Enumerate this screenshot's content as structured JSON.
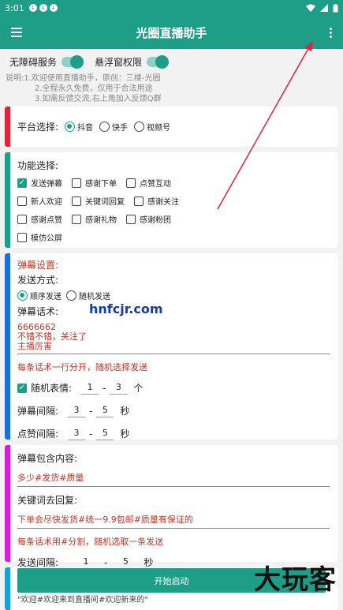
{
  "status_bar": {
    "time": "3:01"
  },
  "app_bar": {
    "title": "光圈直播助手"
  },
  "toggles": [
    {
      "label": "无障碍服务",
      "on": true
    },
    {
      "label": "悬浮窗权限",
      "on": true
    }
  ],
  "intro": {
    "line1": "说明:1.欢迎使用直播助手，原创：三楼-光圈",
    "line2": "2.全程永久免费，仅用于合法用途",
    "line3": "3.如需反馈交流,右上角加入反馈Q群"
  },
  "platform": {
    "label": "平台选择:",
    "options": [
      "抖音",
      "快手",
      "视频号"
    ],
    "selected": "抖音"
  },
  "features": {
    "label": "功能选择:",
    "items": [
      {
        "label": "发送弹幕",
        "checked": true
      },
      {
        "label": "感谢下单",
        "checked": false
      },
      {
        "label": "点赞互动",
        "checked": false
      },
      {
        "label": "新人欢迎",
        "checked": false
      },
      {
        "label": "关键词回复",
        "checked": false
      },
      {
        "label": "感谢关注",
        "checked": false
      },
      {
        "label": "感谢点赞",
        "checked": false
      },
      {
        "label": "感谢礼物",
        "checked": false
      },
      {
        "label": "感谢粉团",
        "checked": false
      },
      {
        "label": "模仿公屏",
        "checked": false
      }
    ]
  },
  "danmu": {
    "title": "弹幕设置:",
    "send_mode_label": "发送方式:",
    "send_modes": [
      "顺序发送",
      "随机发送"
    ],
    "send_mode_selected": "顺序发送",
    "script_label": "弹幕话术:",
    "script_lines": [
      "6666662",
      "不错不错，关注了",
      "主播厉害"
    ],
    "hint": "每条话术一行分开，随机选择发送",
    "random_emoji_label": "随机表情:",
    "random_emoji_checked": true,
    "emoji_min": "1",
    "emoji_max": "3",
    "emoji_unit": "个",
    "interval_label": "弹幕间隔:",
    "interval_min": "3",
    "interval_max": "5",
    "interval_unit": "秒",
    "like_interval_label": "点赞间隔:",
    "like_min": "3",
    "like_max": "5",
    "like_unit": "秒",
    "dash": "-"
  },
  "keywords": {
    "contains_label": "弹幕包含内容:",
    "contains_value": "多少#发货#质量",
    "reply_label": "关键词去回复:",
    "reply_value": "下单会尽快发货#统一9.9包邮#质量有保证的",
    "hint": "每条话术用#分割，随机选取一条发送",
    "interval_label": "发送间隔:",
    "interval_min": "1",
    "interval_max": "5",
    "interval_unit": "秒"
  },
  "welcome": {
    "value": "\"欢迎#欢迎来到直播间#欢迎新来的\""
  },
  "start_button": "开始启动",
  "watermarks": {
    "site": "hnfcjr.com",
    "brand": "大玩客"
  },
  "colors": {
    "primary": "#1f9e87",
    "accent_red": "#e0233e",
    "accent_teal": "#1f9e87",
    "accent_blue": "#1b6fe0",
    "accent_magenta": "#d61fd6",
    "accent_cyan": "#1aa0d8"
  }
}
